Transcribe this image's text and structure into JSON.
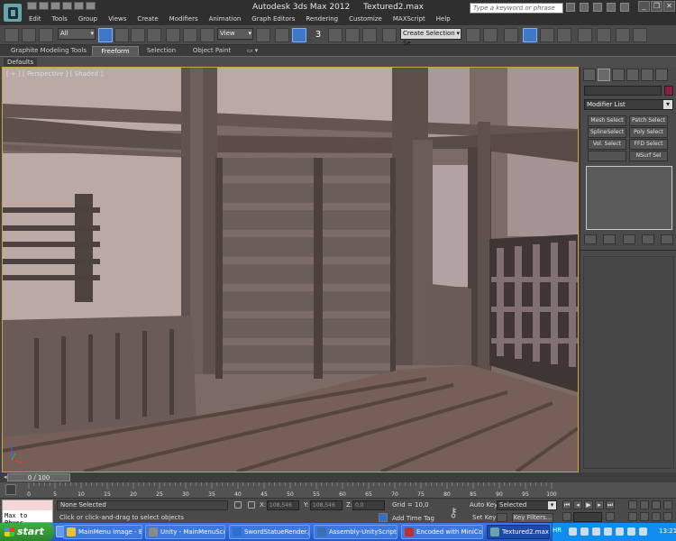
{
  "window": {
    "app_name": "Autodesk 3ds Max  2012",
    "file_name": "Textured2.max",
    "search_placeholder": "Type a keyword or phrase",
    "minimize": "_",
    "restore": "❐",
    "close": "✕"
  },
  "menu": [
    "Edit",
    "Tools",
    "Group",
    "Views",
    "Create",
    "Modifiers",
    "Animation",
    "Graph Editors",
    "Rendering",
    "Customize",
    "MAXScript",
    "Help"
  ],
  "toolbar": {
    "selection_filter": "All",
    "ref_coord": "View",
    "snap_number": "3",
    "named_selection_set": "Create Selection Se"
  },
  "ribbon": {
    "tabs": [
      "Graphite Modeling Tools",
      "Freeform",
      "Selection",
      "Object Paint"
    ],
    "active_tab": "Freeform",
    "panel": "Defaults"
  },
  "viewport": {
    "label": "[ + ] [ Perspective ] [ Shaded ]"
  },
  "command_panel": {
    "modifier_list": "Modifier List",
    "buttons": [
      "Mesh Select",
      "Patch Select",
      "SplineSelect",
      "Poly Select",
      "Vol. Select",
      "FFD Select",
      "NSurf Sel"
    ],
    "colors": {
      "object_color": "#8b1f3f"
    }
  },
  "timeline": {
    "frame_display": "0 / 100",
    "ticks": [
      "0",
      "5",
      "10",
      "15",
      "20",
      "25",
      "30",
      "35",
      "40",
      "45",
      "50",
      "55",
      "60",
      "65",
      "70",
      "75",
      "80",
      "85",
      "90",
      "95",
      "100"
    ]
  },
  "status": {
    "maxscript_text": "Max to Physc.",
    "selection": "None Selected",
    "prompt": "Click or click-and-drag to select objects",
    "x_label": "X:",
    "x_value": "108,546",
    "y_label": "Y:",
    "y_value": "108,546",
    "z_label": "Z:",
    "z_value": "0,0",
    "grid": "Grid = 10,0",
    "add_time_tag": "Add Time Tag",
    "auto_key": "Auto Key",
    "set_key": "Set Key",
    "selected_option": "Selected",
    "key_filters": "Key Filters..."
  },
  "taskbar": {
    "start": "start",
    "tasks": [
      "MainMenu image - Be...",
      "Unity - MainMenuSce...",
      "SwordStatueRender.j...",
      "Assembly-UnityScript ...",
      "Encoded with MiniCod...",
      "Textured2.max - Aut..."
    ],
    "language": "HR",
    "clock": "13:21"
  }
}
